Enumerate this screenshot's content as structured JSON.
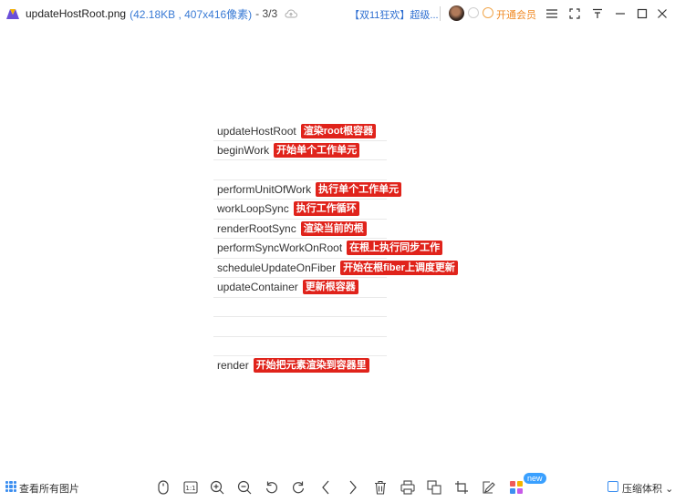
{
  "titlebar": {
    "file_name": "updateHostRoot.png",
    "file_meta": "(42.18KB , 407x416像素)",
    "counter": "- 3/3",
    "promo": "【双11狂欢】超级...",
    "vip_label": "开通会员"
  },
  "content": {
    "rows": [
      {
        "name": "updateHostRoot",
        "tag": "渲染root根容器"
      },
      {
        "name": "beginWork",
        "tag": "开始单个工作单元"
      },
      {
        "name": "",
        "tag": ""
      },
      {
        "name": "performUnitOfWork",
        "tag": "执行单个工作单元"
      },
      {
        "name": "workLoopSync",
        "tag": "执行工作循环"
      },
      {
        "name": "renderRootSync",
        "tag": "渲染当前的根"
      },
      {
        "name": "performSyncWorkOnRoot",
        "tag": "在根上执行同步工作"
      },
      {
        "name": "scheduleUpdateOnFiber",
        "tag": "开始在根fiber上调度更新"
      },
      {
        "name": "updateContainer",
        "tag": "更新根容器"
      },
      {
        "name": "",
        "tag": ""
      },
      {
        "name": "",
        "tag": ""
      },
      {
        "name": "",
        "tag": ""
      },
      {
        "name": "render",
        "tag": "开始把元素渲染到容器里"
      }
    ]
  },
  "bottombar": {
    "view_all": "查看所有图片",
    "new_badge": "new",
    "compress": "压缩体积",
    "compress_arrow": "⌄"
  },
  "colors": {
    "accent": "#3a7bd5",
    "tag_bg": "#e0231b",
    "vip": "#f08a24"
  }
}
